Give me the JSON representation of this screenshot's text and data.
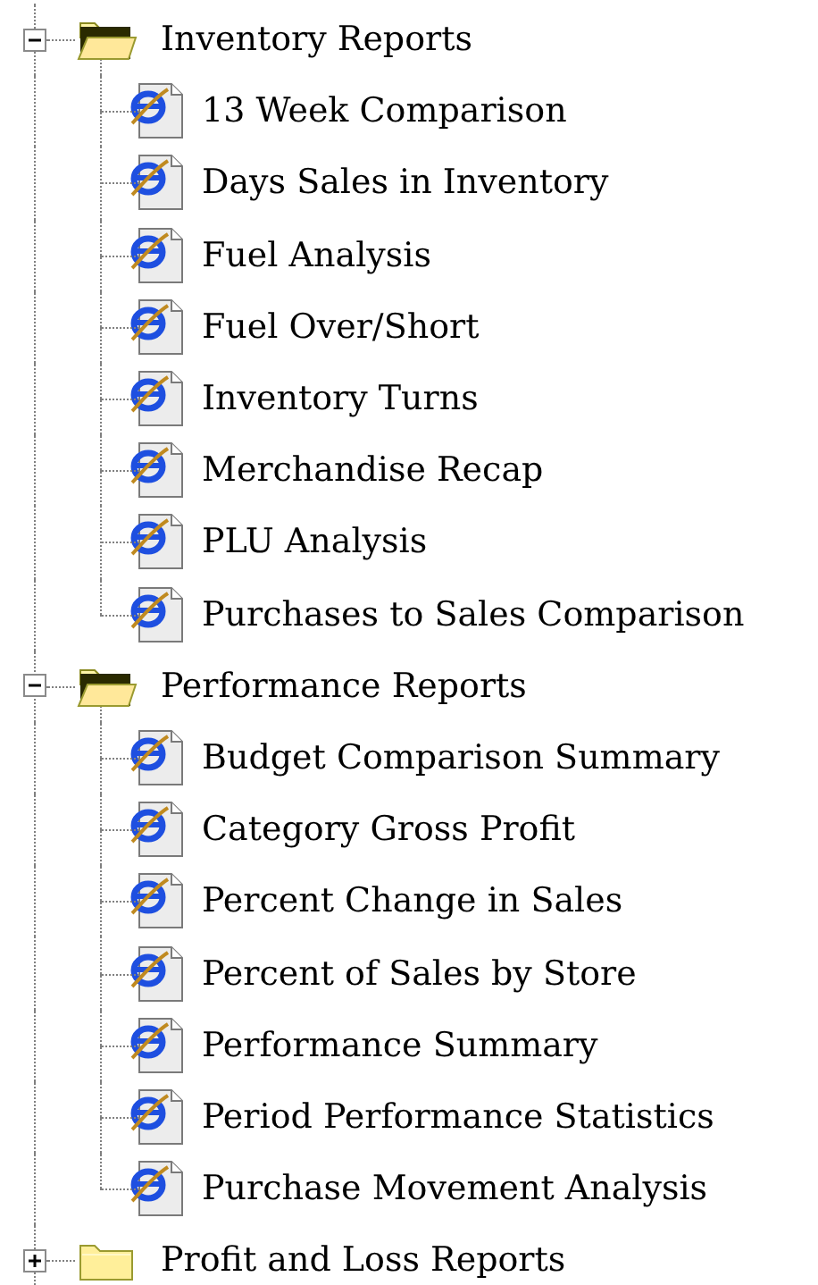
{
  "tree": [
    {
      "label": "Inventory Reports",
      "expanded": true,
      "children": [
        {
          "label": "13 Week Comparison"
        },
        {
          "label": "Days Sales in Inventory"
        },
        {
          "label": "Fuel Analysis"
        },
        {
          "label": "Fuel Over/Short"
        },
        {
          "label": "Inventory Turns"
        },
        {
          "label": "Merchandise Recap"
        },
        {
          "label": "PLU Analysis"
        },
        {
          "label": "Purchases to Sales Comparison"
        }
      ]
    },
    {
      "label": "Performance Reports",
      "expanded": true,
      "children": [
        {
          "label": "Budget Comparison Summary"
        },
        {
          "label": "Category Gross Profit"
        },
        {
          "label": "Percent Change in Sales"
        },
        {
          "label": "Percent of Sales by Store"
        },
        {
          "label": "Performance Summary"
        },
        {
          "label": "Period Performance Statistics"
        },
        {
          "label": "Purchase Movement Analysis"
        }
      ]
    },
    {
      "label": "Profit and Loss Reports",
      "expanded": false
    }
  ]
}
